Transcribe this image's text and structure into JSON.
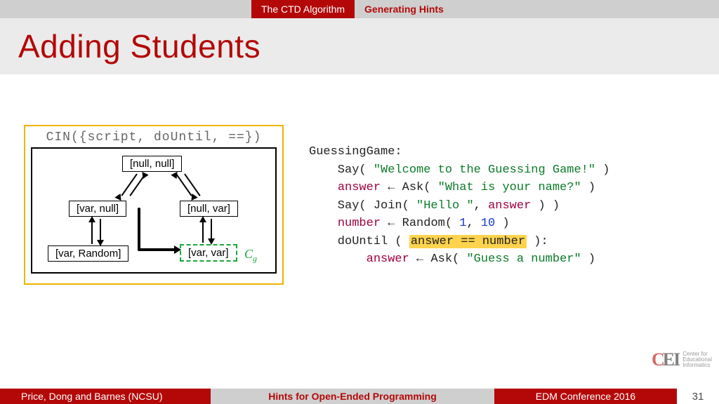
{
  "nav": {
    "active": "The CTD Algorithm",
    "inactive": "Generating Hints"
  },
  "title": "Adding Students",
  "diagram": {
    "header": "CIN({script, doUntil, ==})",
    "nodes": {
      "n1": "[null, null]",
      "n2": "[var, null]",
      "n3": "[null, var]",
      "n4": "[var, Random]",
      "n5": "[var, var]"
    },
    "cg": "C",
    "cg_sub": "g"
  },
  "code": {
    "l1a": "GuessingGame:",
    "l2a": "    Say( ",
    "l2b": "\"Welcome to the Guessing Game!\"",
    "l2c": " )",
    "l3a": "    ",
    "l3k": "answer",
    "l3b": " ← Ask( ",
    "l3c": "\"What is your name?\"",
    "l3d": " )",
    "l4a": "    Say( Join( ",
    "l4b": "\"Hello \"",
    "l4c": ", ",
    "l4k": "answer",
    "l4d": " ) )",
    "l5a": "    ",
    "l5k": "number",
    "l5b": " ← Random( ",
    "l5n1": "1",
    "l5c": ", ",
    "l5n2": "10",
    "l5d": " )",
    "l6a": "    doUntil ( ",
    "l6h": "answer == number",
    "l6b": " ):",
    "l7a": "        ",
    "l7k": "answer",
    "l7b": " ← Ask( ",
    "l7c": "\"Guess a number\"",
    "l7d": " )"
  },
  "footer": {
    "authors": "Price, Dong and Barnes (NCSU)",
    "title": "Hints for Open-Ended Programming",
    "venue": "EDM Conference 2016",
    "page": "31"
  },
  "logo": {
    "c": "C",
    "e": "E",
    "i": "I",
    "l1": "Center for",
    "l2": "Educational",
    "l3": "Informatics"
  }
}
